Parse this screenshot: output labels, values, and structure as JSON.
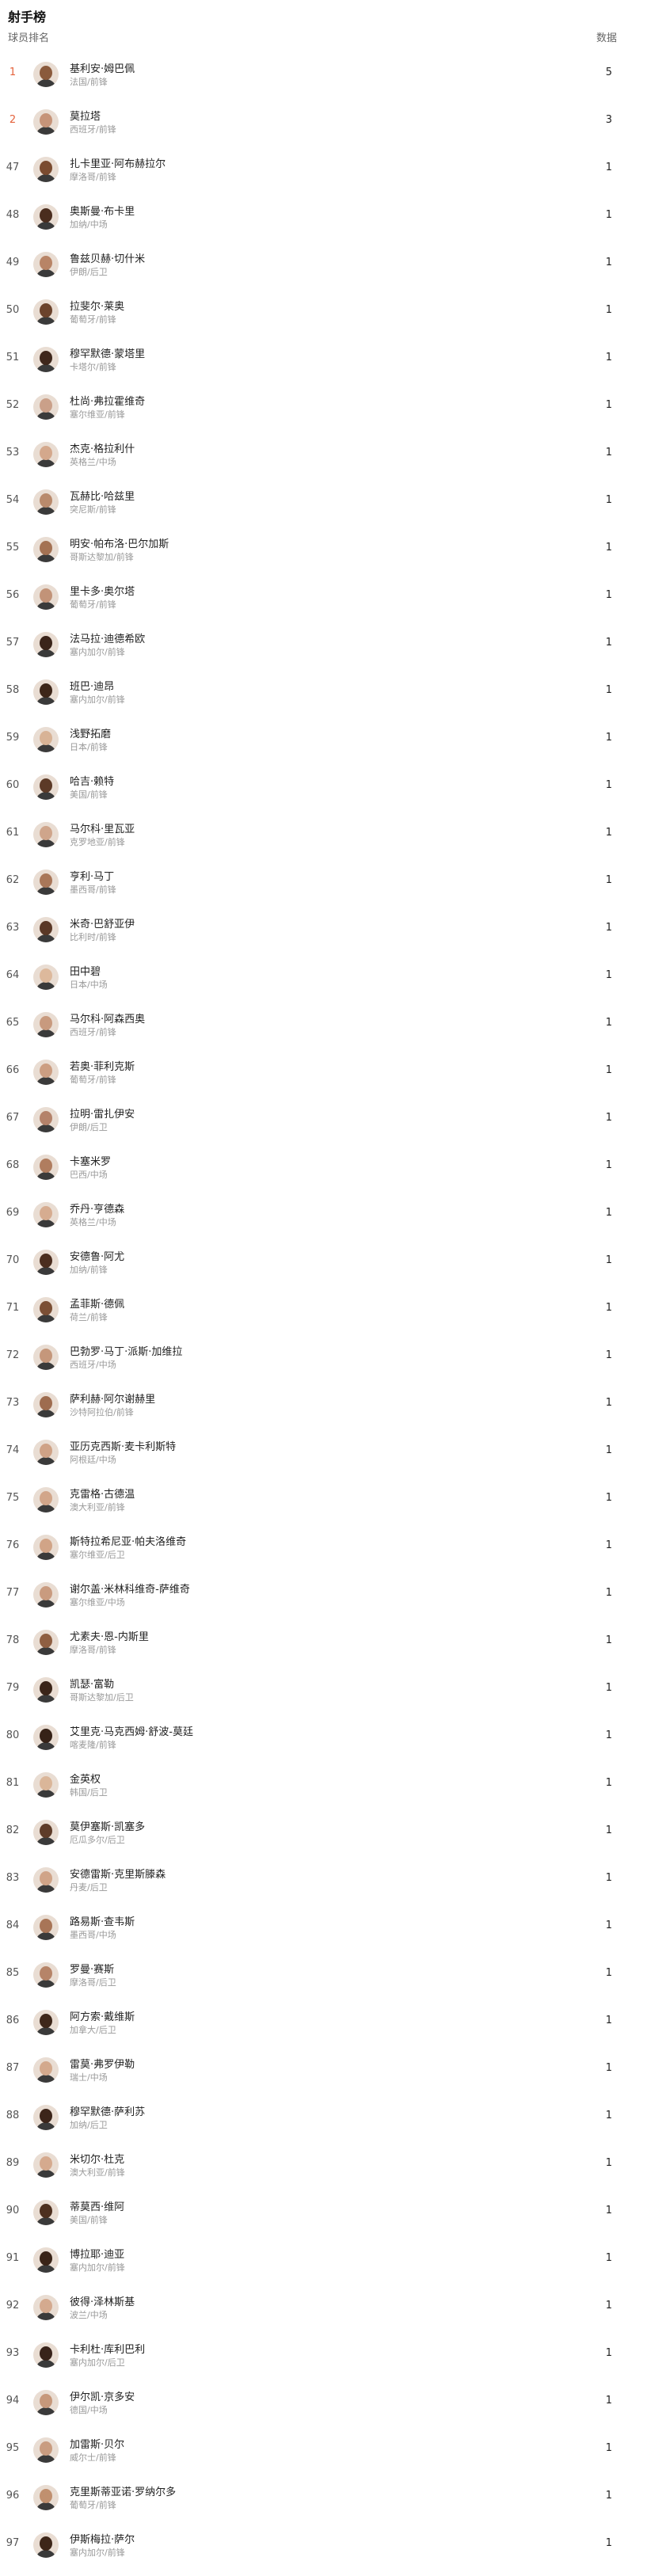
{
  "page": {
    "title": "射手榜",
    "col_player": "球员排名",
    "col_value": "数据"
  },
  "colors": {
    "top_rank": "#e4623c",
    "rank": "#555555",
    "name": "#222222",
    "meta": "#999999"
  },
  "rows": [
    {
      "rank": "1",
      "name": "基利安·姆巴佩",
      "meta": "法国/前锋",
      "value": "5",
      "top": true,
      "skin": "#8a5a3c"
    },
    {
      "rank": "2",
      "name": "莫拉塔",
      "meta": "西班牙/前锋",
      "value": "3",
      "top": true,
      "skin": "#c69479"
    },
    {
      "rank": "47",
      "name": "扎卡里亚·阿布赫拉尔",
      "meta": "摩洛哥/前锋",
      "value": "1",
      "skin": "#7a4b30"
    },
    {
      "rank": "48",
      "name": "奥斯曼·布卡里",
      "meta": "加纳/中场",
      "value": "1",
      "skin": "#4a2d1e"
    },
    {
      "rank": "49",
      "name": "鲁兹贝赫·切什米",
      "meta": "伊朗/后卫",
      "value": "1",
      "skin": "#b88466"
    },
    {
      "rank": "50",
      "name": "拉斐尔·莱奥",
      "meta": "葡萄牙/前锋",
      "value": "1",
      "skin": "#6b432c"
    },
    {
      "rank": "51",
      "name": "穆罕默德·蒙塔里",
      "meta": "卡塔尔/前锋",
      "value": "1",
      "skin": "#3f271b"
    },
    {
      "rank": "52",
      "name": "杜尚·弗拉霍维奇",
      "meta": "塞尔维亚/前锋",
      "value": "1",
      "skin": "#caa089"
    },
    {
      "rank": "53",
      "name": "杰克·格拉利什",
      "meta": "英格兰/中场",
      "value": "1",
      "skin": "#d4a88c"
    },
    {
      "rank": "54",
      "name": "瓦赫比·哈兹里",
      "meta": "突尼斯/前锋",
      "value": "1",
      "skin": "#b98a6c"
    },
    {
      "rank": "55",
      "name": "明安·帕布洛·巴尔加斯",
      "meta": "哥斯达黎加/前锋",
      "value": "1",
      "skin": "#a47253"
    },
    {
      "rank": "56",
      "name": "里卡多·奥尔塔",
      "meta": "葡萄牙/前锋",
      "value": "1",
      "skin": "#c29378"
    },
    {
      "rank": "57",
      "name": "法马拉·迪德希欧",
      "meta": "塞内加尔/前锋",
      "value": "1",
      "skin": "#3a241a"
    },
    {
      "rank": "58",
      "name": "班巴·迪昂",
      "meta": "塞内加尔/前锋",
      "value": "1",
      "skin": "#3d2619"
    },
    {
      "rank": "59",
      "name": "浅野拓磨",
      "meta": "日本/前锋",
      "value": "1",
      "skin": "#d8b396"
    },
    {
      "rank": "60",
      "name": "哈吉·赖特",
      "meta": "美国/前锋",
      "value": "1",
      "skin": "#5c3a27"
    },
    {
      "rank": "61",
      "name": "马尔科·里瓦亚",
      "meta": "克罗地亚/前锋",
      "value": "1",
      "skin": "#cfa58b"
    },
    {
      "rank": "62",
      "name": "亨利·马丁",
      "meta": "墨西哥/前锋",
      "value": "1",
      "skin": "#a97759"
    },
    {
      "rank": "63",
      "name": "米奇·巴舒亚伊",
      "meta": "比利时/前锋",
      "value": "1",
      "skin": "#5a3826"
    },
    {
      "rank": "64",
      "name": "田中碧",
      "meta": "日本/中场",
      "value": "1",
      "skin": "#ddb99c"
    },
    {
      "rank": "65",
      "name": "马尔科·阿森西奥",
      "meta": "西班牙/前锋",
      "value": "1",
      "skin": "#c89a7e"
    },
    {
      "rank": "66",
      "name": "若奥·菲利克斯",
      "meta": "葡萄牙/前锋",
      "value": "1",
      "skin": "#cc9e82"
    },
    {
      "rank": "67",
      "name": "拉明·雷扎伊安",
      "meta": "伊朗/后卫",
      "value": "1",
      "skin": "#b4826a"
    },
    {
      "rank": "68",
      "name": "卡塞米罗",
      "meta": "巴西/中场",
      "value": "1",
      "skin": "#b07d5f"
    },
    {
      "rank": "69",
      "name": "乔丹·亨德森",
      "meta": "英格兰/中场",
      "value": "1",
      "skin": "#d6ac90"
    },
    {
      "rank": "70",
      "name": "安德鲁·阿尤",
      "meta": "加纳/前锋",
      "value": "1",
      "skin": "#4b2e1f"
    },
    {
      "rank": "71",
      "name": "孟菲斯·德佩",
      "meta": "荷兰/前锋",
      "value": "1",
      "skin": "#7b4f35"
    },
    {
      "rank": "72",
      "name": "巴勃罗·马丁·派斯·加维拉",
      "meta": "西班牙/中场",
      "value": "1",
      "skin": "#c5977b"
    },
    {
      "rank": "73",
      "name": "萨利赫·阿尔谢赫里",
      "meta": "沙特阿拉伯/前锋",
      "value": "1",
      "skin": "#9e6c4f"
    },
    {
      "rank": "74",
      "name": "亚历克西斯·麦卡利斯特",
      "meta": "阿根廷/中场",
      "value": "1",
      "skin": "#cfa286"
    },
    {
      "rank": "75",
      "name": "克雷格·古德温",
      "meta": "澳大利亚/前锋",
      "value": "1",
      "skin": "#d2a68a"
    },
    {
      "rank": "76",
      "name": "斯特拉希尼亚·帕夫洛维奇",
      "meta": "塞尔维亚/后卫",
      "value": "1",
      "skin": "#d1a487"
    },
    {
      "rank": "77",
      "name": "谢尔盖·米林科维奇-萨维奇",
      "meta": "塞尔维亚/中场",
      "value": "1",
      "skin": "#c99b7f"
    },
    {
      "rank": "78",
      "name": "尤素夫·恩-内斯里",
      "meta": "摩洛哥/前锋",
      "value": "1",
      "skin": "#8f5f42"
    },
    {
      "rank": "79",
      "name": "凯瑟·富勒",
      "meta": "哥斯达黎加/后卫",
      "value": "1",
      "skin": "#3b2519"
    },
    {
      "rank": "80",
      "name": "艾里克·马克西姆·舒波-莫廷",
      "meta": "喀麦隆/前锋",
      "value": "1",
      "skin": "#362217"
    },
    {
      "rank": "81",
      "name": "金英权",
      "meta": "韩国/后卫",
      "value": "1",
      "skin": "#dab699"
    },
    {
      "rank": "82",
      "name": "莫伊塞斯·凯塞多",
      "meta": "厄瓜多尔/后卫",
      "value": "1",
      "skin": "#5e3c29"
    },
    {
      "rank": "83",
      "name": "安德雷斯·克里斯滕森",
      "meta": "丹麦/后卫",
      "value": "1",
      "skin": "#d0a488"
    },
    {
      "rank": "84",
      "name": "路易斯·查韦斯",
      "meta": "墨西哥/中场",
      "value": "1",
      "skin": "#a87557"
    },
    {
      "rank": "85",
      "name": "罗曼·赛斯",
      "meta": "摩洛哥/后卫",
      "value": "1",
      "skin": "#b68468"
    },
    {
      "rank": "86",
      "name": "阿方索·戴维斯",
      "meta": "加拿大/后卫",
      "value": "1",
      "skin": "#3e271a"
    },
    {
      "rank": "87",
      "name": "雷莫·弗罗伊勒",
      "meta": "瑞士/中场",
      "value": "1",
      "skin": "#d3a98d"
    },
    {
      "rank": "88",
      "name": "穆罕默德·萨利苏",
      "meta": "加纳/后卫",
      "value": "1",
      "skin": "#3c251a"
    },
    {
      "rank": "89",
      "name": "米切尔·杜克",
      "meta": "澳大利亚/前锋",
      "value": "1",
      "skin": "#d5aa8e"
    },
    {
      "rank": "90",
      "name": "蒂莫西·维阿",
      "meta": "美国/前锋",
      "value": "1",
      "skin": "#4d301f"
    },
    {
      "rank": "91",
      "name": "博拉耶·迪亚",
      "meta": "塞内加尔/前锋",
      "value": "1",
      "skin": "#3a2418"
    },
    {
      "rank": "92",
      "name": "彼得·泽林斯基",
      "meta": "波兰/中场",
      "value": "1",
      "skin": "#d4aa8f"
    },
    {
      "rank": "93",
      "name": "卡利杜·库利巴利",
      "meta": "塞内加尔/后卫",
      "value": "1",
      "skin": "#38231a"
    },
    {
      "rank": "94",
      "name": "伊尔凯·京多安",
      "meta": "德国/中场",
      "value": "1",
      "skin": "#c6987b"
    },
    {
      "rank": "95",
      "name": "加雷斯·贝尔",
      "meta": "威尔士/前锋",
      "value": "1",
      "skin": "#c99c80"
    },
    {
      "rank": "96",
      "name": "克里斯蒂亚诺·罗纳尔多",
      "meta": "葡萄牙/前锋",
      "value": "1",
      "skin": "#c0906f"
    },
    {
      "rank": "97",
      "name": "伊斯梅拉·萨尔",
      "meta": "塞内加尔/前锋",
      "value": "1",
      "skin": "#3d2619"
    }
  ]
}
